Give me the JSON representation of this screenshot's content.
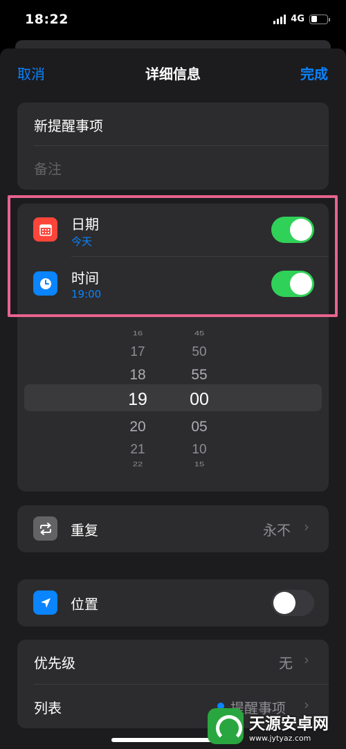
{
  "status": {
    "time": "18:22",
    "network": "4G"
  },
  "nav": {
    "cancel": "取消",
    "title": "详细信息",
    "done": "完成"
  },
  "reminder": {
    "title": "新提醒事项",
    "notes_placeholder": "备注"
  },
  "date_row": {
    "label": "日期",
    "value": "今天",
    "enabled": true
  },
  "time_row": {
    "label": "时间",
    "value": "19:00",
    "enabled": true
  },
  "picker": {
    "hours": [
      "16",
      "17",
      "18",
      "19",
      "20",
      "21",
      "22"
    ],
    "minutes": [
      "45",
      "50",
      "55",
      "00",
      "05",
      "10",
      "15"
    ],
    "selected_hour": "19",
    "selected_minute": "00"
  },
  "repeat": {
    "label": "重复",
    "value": "永不"
  },
  "location": {
    "label": "位置",
    "enabled": false
  },
  "priority": {
    "label": "优先级",
    "value": "无"
  },
  "list": {
    "label": "列表",
    "value": "提醒事项"
  },
  "colors": {
    "accent": "#0a84ff",
    "toggle_on": "#30d158",
    "highlight": "#e8638f",
    "calendar_icon": "#ff453a",
    "clock_icon": "#0a84ff",
    "repeat_icon": "#636366",
    "location_icon": "#0a84ff"
  },
  "watermark": {
    "title": "天源安卓网",
    "url": "www.jytyaz.com"
  }
}
